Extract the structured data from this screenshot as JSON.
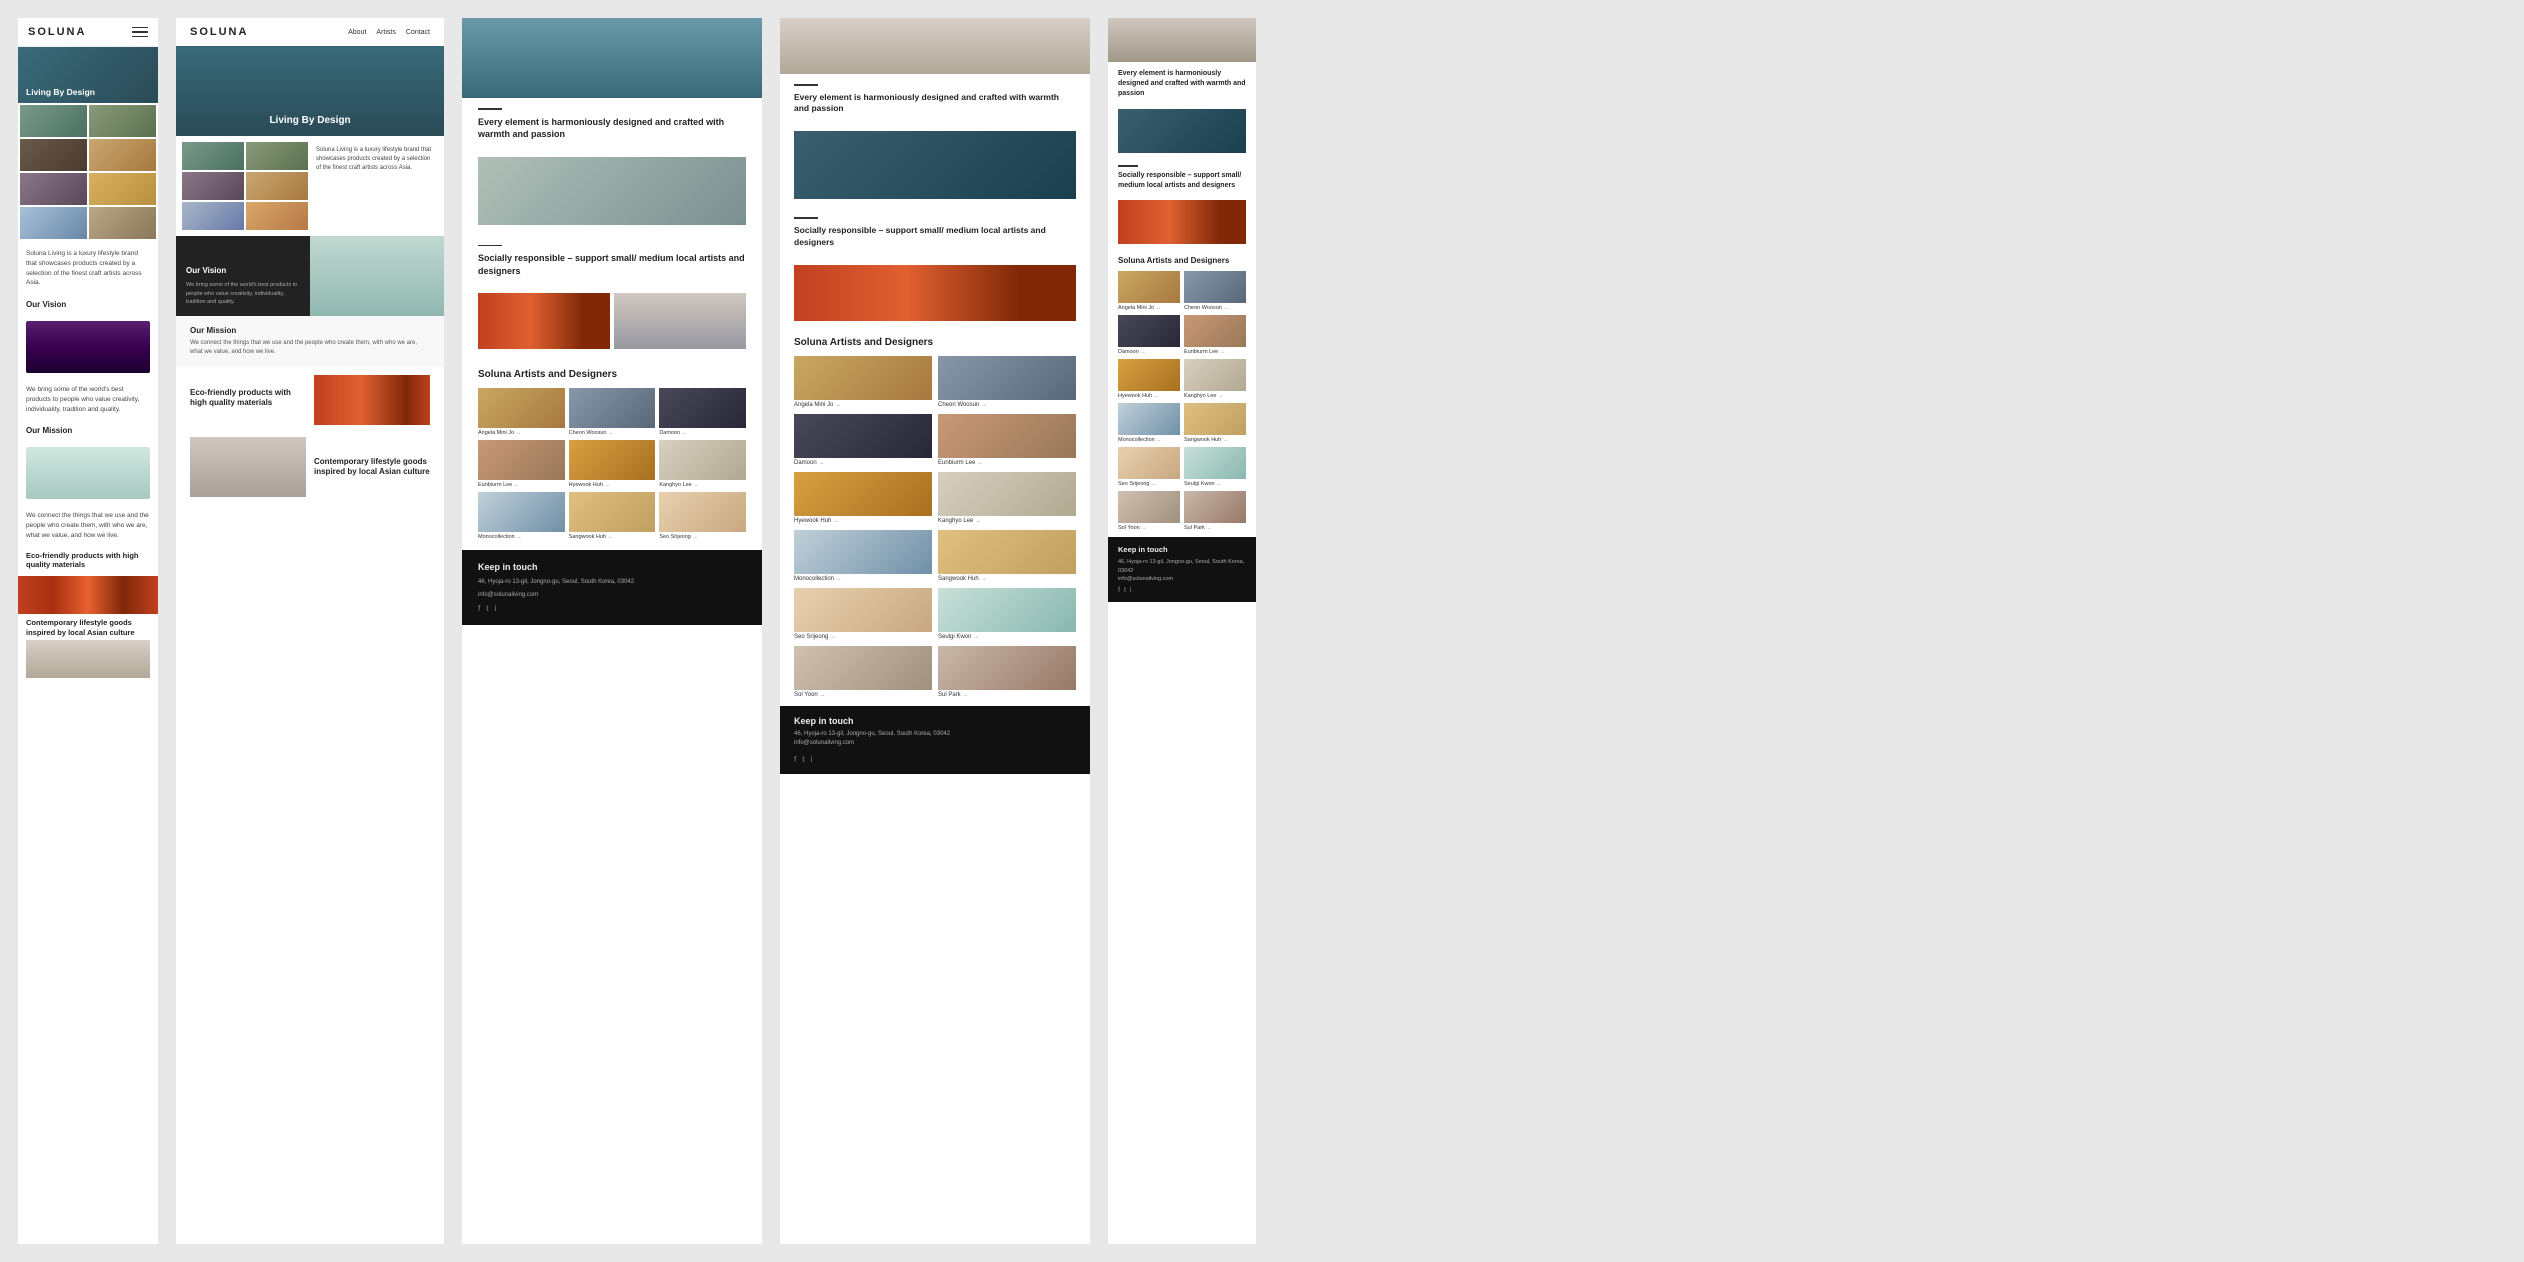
{
  "brand": {
    "name": "SOLUNA"
  },
  "nav": {
    "links": [
      "About",
      "Artists",
      "Contact"
    ]
  },
  "hero": {
    "title": "Living By Design"
  },
  "intro": {
    "text": "Soluna Living is a luxury lifestyle brand that showcases products created by a selection of the finest craft artists across Asia."
  },
  "vision": {
    "title": "Our Vision",
    "text": "We bring some of the world's best products to people who value creativity, individuality, tradition and quality."
  },
  "mission": {
    "title": "Our Mission",
    "text": "We connect the things that we use and the people who create them, with who we are, what we value, and how we live."
  },
  "eco": {
    "title": "Eco-friendly products with high quality materials"
  },
  "contemporary": {
    "title": "Contemporary lifestyle goods inspired by local Asian culture"
  },
  "about_section1": {
    "heading": "Every element is harmoniously designed and crafted with warmth and passion"
  },
  "about_section2": {
    "heading": "Socially responsible – support small/ medium local artists and designers"
  },
  "artists_section": {
    "title": "Soluna Artists and Designers",
    "artists": [
      {
        "name": "Angela Mini Jo",
        "link": "→"
      },
      {
        "name": "Cheon Woosun",
        "link": "→"
      },
      {
        "name": "Damoon",
        "link": "→"
      },
      {
        "name": "Eunbiurm Lee",
        "link": "→"
      },
      {
        "name": "Hyewook Huh",
        "link": "→"
      },
      {
        "name": "Kanghyo Lee",
        "link": "→"
      },
      {
        "name": "Monocollection",
        "link": "→"
      },
      {
        "name": "Sangwook Huh",
        "link": "→"
      },
      {
        "name": "Seo Srijeong",
        "link": "→"
      },
      {
        "name": "Seulgi Kwon",
        "link": "→"
      },
      {
        "name": "Sol Yoon",
        "link": "→"
      },
      {
        "name": "Sul Park",
        "link": "→"
      }
    ]
  },
  "footer": {
    "title": "Keep in touch",
    "address": "46, Hyoja-ro 13-gil, Jongno-gu, Seoul, South Korea, 03042",
    "email": "info@solunaliving.com",
    "social": [
      "f",
      "t",
      "i"
    ]
  }
}
